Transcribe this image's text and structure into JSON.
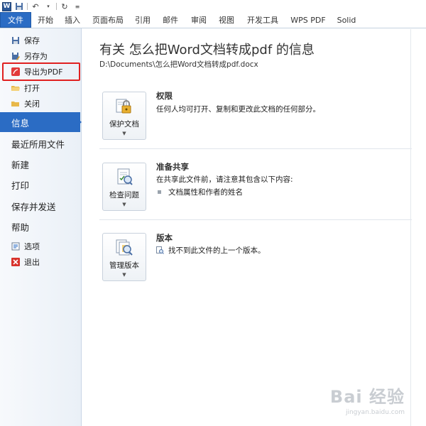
{
  "tabs": [
    {
      "label": "文件",
      "active": true
    },
    {
      "label": "开始"
    },
    {
      "label": "插入"
    },
    {
      "label": "页面布局"
    },
    {
      "label": "引用"
    },
    {
      "label": "邮件"
    },
    {
      "label": "审阅"
    },
    {
      "label": "视图"
    },
    {
      "label": "开发工具"
    },
    {
      "label": "WPS PDF"
    },
    {
      "label": "Solid"
    }
  ],
  "nav": {
    "save": "保存",
    "save_as": "另存为",
    "export_pdf": "导出为PDF",
    "open": "打开",
    "close": "关闭",
    "info": "信息",
    "recent": "最近所用文件",
    "new": "新建",
    "print": "打印",
    "save_send": "保存并发送",
    "help": "帮助",
    "options": "选项",
    "exit": "退出"
  },
  "main": {
    "title": "有关 怎么把Word文档转成pdf 的信息",
    "path": "D:\\Documents\\怎么把Word文档转成pdf.docx",
    "permissions": {
      "button": "保护文档",
      "title": "权限",
      "desc": "任何人均可打开、复制和更改此文档的任何部分。"
    },
    "prepare": {
      "button": "检查问题",
      "title": "准备共享",
      "desc": "在共享此文件前，请注意其包含以下内容:",
      "bullet": "文档属性和作者的姓名"
    },
    "versions": {
      "button": "管理版本",
      "title": "版本",
      "desc": "找不到此文件的上一个版本。"
    }
  },
  "watermark": {
    "main": "Bai 经验",
    "sub": "jingyan.baidu.com"
  },
  "colors": {
    "accent": "#2b6cc4",
    "highlight": "#e02020"
  }
}
